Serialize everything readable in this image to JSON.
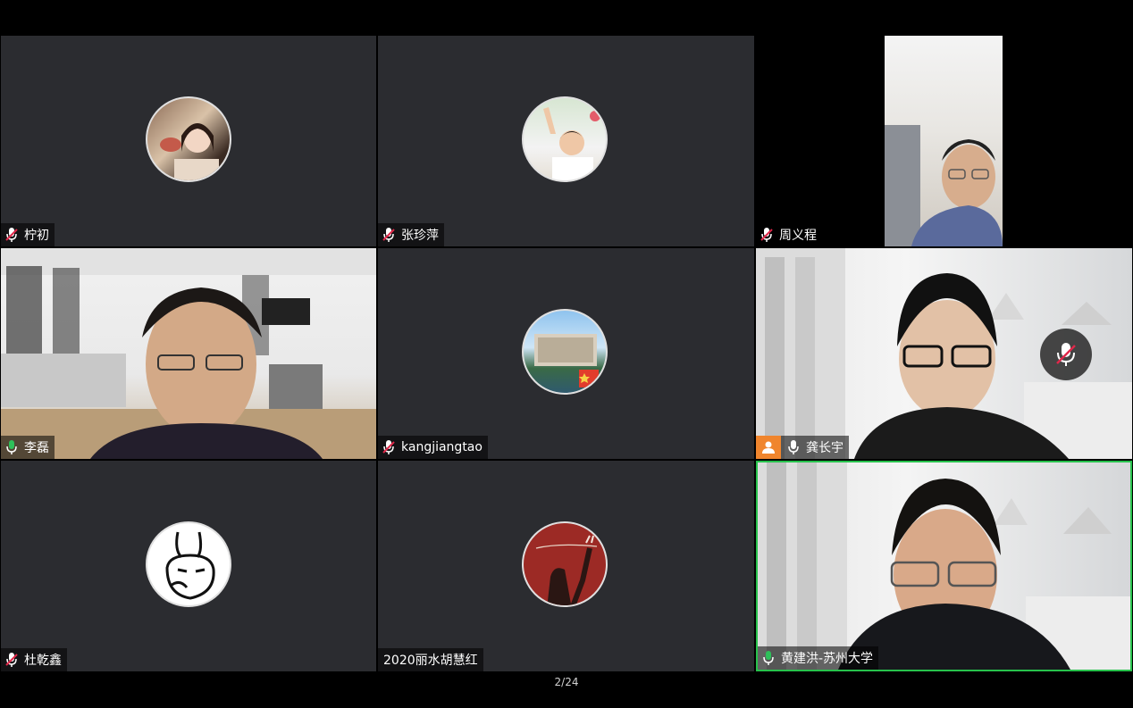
{
  "pager": "2/24",
  "participants": [
    {
      "name": "柠初",
      "mic": "muted"
    },
    {
      "name": "张珍萍",
      "mic": "muted"
    },
    {
      "name": "周义程",
      "mic": "muted"
    },
    {
      "name": "李磊",
      "mic": "active"
    },
    {
      "name": "kangjiangtao",
      "mic": "muted"
    },
    {
      "name": "龚长宇",
      "mic": "active"
    },
    {
      "name": "杜乾鑫",
      "mic": "muted"
    },
    {
      "name": "2020丽水胡慧红",
      "mic": "none"
    },
    {
      "name": "黄建洪-苏州大学",
      "mic": "active"
    }
  ],
  "colors": {
    "tile_bg": "#2b2c30",
    "speaking_border": "#27c24c",
    "muted_mic": "#e0284a",
    "badge": "#f0852d"
  }
}
